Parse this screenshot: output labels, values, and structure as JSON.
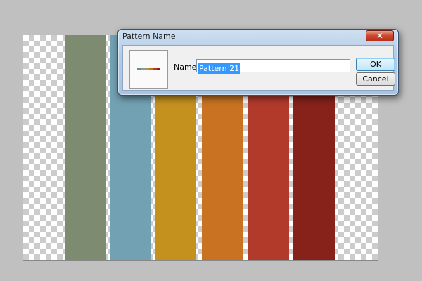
{
  "canvas": {
    "stripes": [
      {
        "name": "sage-green",
        "color": "#7d8c70"
      },
      {
        "name": "steel-blue",
        "color": "#72a1b3"
      },
      {
        "name": "mustard",
        "color": "#c4911f"
      },
      {
        "name": "orange",
        "color": "#c97322"
      },
      {
        "name": "red",
        "color": "#b23a2b"
      },
      {
        "name": "dark-red",
        "color": "#862219"
      }
    ]
  },
  "dialog": {
    "title": "Pattern Name",
    "close_icon": "close-icon",
    "close_glyph": "✕",
    "name_label": "Name:",
    "name_value": "Pattern 21",
    "ok_label": "OK",
    "cancel_label": "Cancel",
    "preview_colors": [
      "#7d8c70",
      "#72a1b3",
      "#c4911f",
      "#c97322",
      "#b23a2b",
      "#862219"
    ]
  }
}
